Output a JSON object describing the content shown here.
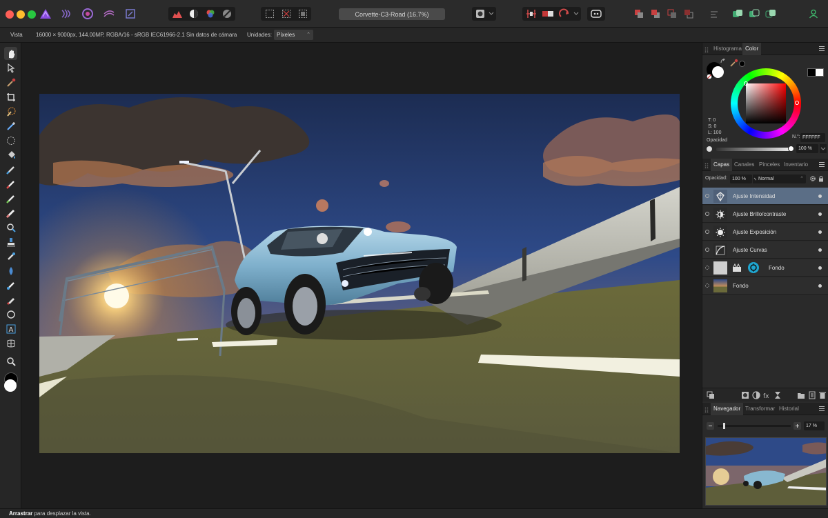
{
  "window": {
    "doc_title": "Corvette-C3-Road (16.7%)"
  },
  "toolbar": {
    "icons": [
      "affinity-photo-logo-icon",
      "liquify-persona-icon",
      "develop-persona-icon",
      "tone-mapping-persona-icon",
      "export-persona-icon",
      "levels-icon",
      "auto-contrast-icon",
      "auto-colors-icon",
      "auto-white-balance-icon",
      "marquee-select-icon",
      "deselect-icon",
      "invert-selection-icon",
      "quick-mask-icon",
      "assistant-icon",
      "arrange-icons",
      "user-icon"
    ]
  },
  "context_bar": {
    "view_label": "Vista",
    "doc_info": "16000 × 9000px, 144.00MP, RGBA/16 - sRGB IEC61966-2.1",
    "camera": "Sin datos de cámara",
    "units_label": "Unidades:",
    "units_value": "Píxeles"
  },
  "tools": [
    "view-tool",
    "move-tool",
    "color-picker-tool",
    "crop-tool",
    "selection-brush-tool",
    "flood-select-tool",
    "freehand-select-tool",
    "flood-fill-tool",
    "paint-brush-tool",
    "pixel-tool",
    "erase-brush-tool",
    "clone-brush-tool",
    "dodge-brush-tool",
    "blemish-remover-tool",
    "smudge-brush-tool",
    "blur-brush-tool",
    "sponge-brush-tool",
    "pen-tool",
    "ellipse-tool",
    "artistic-text-tool",
    "mesh-warp-tool",
    "zoom-tool"
  ],
  "color_panel": {
    "tabs": [
      "Histograma",
      "Color"
    ],
    "active_tab": "Color",
    "t_label": "T: 0",
    "s_label": "S: 0",
    "l_label": "L: 100",
    "hex_label": "N.°:",
    "hex_value": "FFFFFF",
    "opacity_label": "Opacidad",
    "opacity_value": "100 %"
  },
  "layers_panel": {
    "tabs": [
      "Capas",
      "Canales",
      "Pinceles",
      "Inventario"
    ],
    "active_tab": "Capas",
    "opacity_label": "Opacidad:",
    "opacity_value": "100 %",
    "blend_mode": "Normal",
    "layers": [
      {
        "name": "Ajuste Intensidad",
        "selected": true,
        "icon": "vibrance-icon"
      },
      {
        "name": "Ajuste Brillo/contraste",
        "selected": false,
        "icon": "brightness-contrast-icon"
      },
      {
        "name": "Ajuste Exposición",
        "selected": false,
        "icon": "exposure-icon"
      },
      {
        "name": "Ajuste Curvas",
        "selected": false,
        "icon": "curves-icon"
      },
      {
        "name": "Fondo",
        "selected": false,
        "icon": "live-filter-icon"
      },
      {
        "name": "Fondo",
        "selected": false,
        "icon": "pixel-layer-thumbnail"
      }
    ]
  },
  "navigator_panel": {
    "tabs": [
      "Navegador",
      "Transformar",
      "Historial"
    ],
    "active_tab": "Navegador",
    "zoom_value": "17 %"
  },
  "status": {
    "action": "Arrastrar",
    "hint": "para desplazar la vista."
  },
  "colors": {
    "selected_layer": "#5b6e86",
    "accent_purple": "#7b3fd0"
  }
}
